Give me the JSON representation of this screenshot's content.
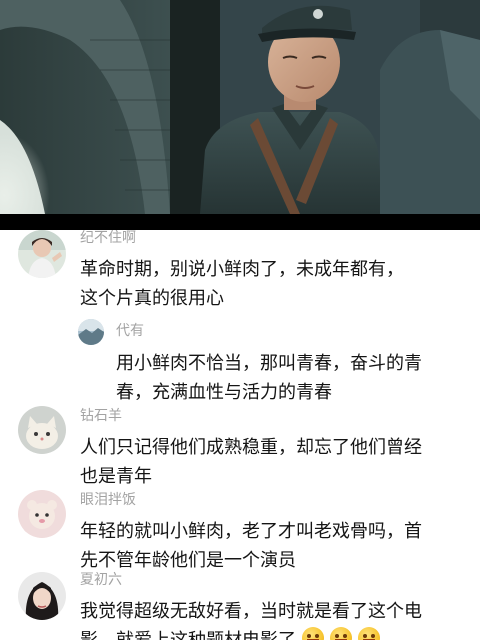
{
  "comments": [
    {
      "username": "纪不住啊",
      "avatar_icon": "girl-photo-avatar",
      "lines": [
        "革命时期，别说小鲜肉了，未成年都有，",
        "这个片真的很用心"
      ],
      "reply": {
        "username": "代有",
        "avatar_icon": "landscape-photo-avatar",
        "lines": [
          "用小鲜肉不恰当，那叫青春，奋斗的青",
          "春，充满血性与活力的青春"
        ]
      }
    },
    {
      "username": "钻石羊",
      "avatar_icon": "cat-photo-avatar",
      "lines": [
        "人们只记得他们成熟稳重，却忘了他们曾经",
        "也是青年"
      ]
    },
    {
      "username": "眼泪拌饭",
      "avatar_icon": "plush-toy-avatar",
      "lines": [
        "年轻的就叫小鲜肉，老了才叫老戏骨吗，首",
        "先不管年龄他们是一个演员"
      ]
    },
    {
      "username": "夏初六",
      "avatar_icon": "woman-portrait-avatar",
      "lines": [
        "我觉得超级无敌好看，当时就是看了这个电",
        "影，就爱上这种题材电影了"
      ],
      "trailing_emojis": [
        "grin-emoji",
        "grin-emoji",
        "grin-emoji"
      ]
    }
  ]
}
